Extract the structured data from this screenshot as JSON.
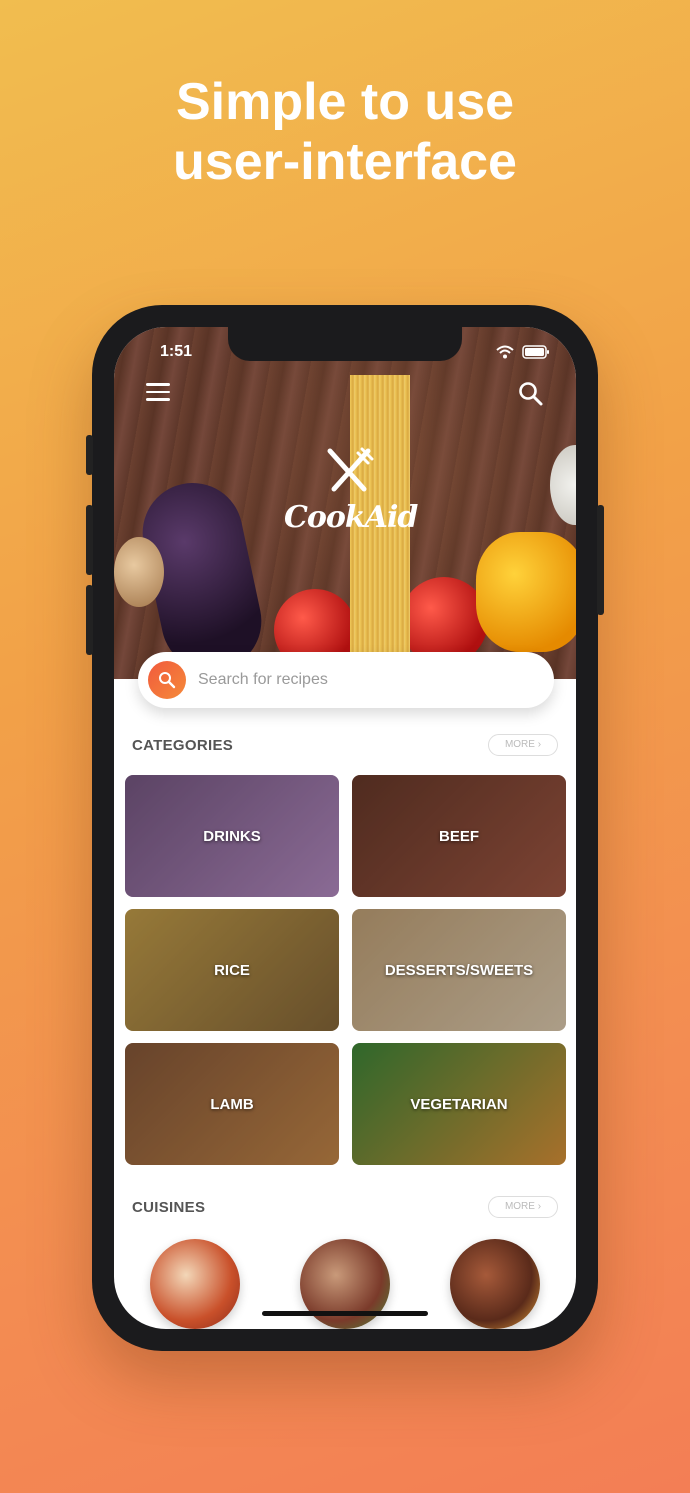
{
  "headline": {
    "line1": "Simple to use",
    "line2": "user-interface"
  },
  "status_bar": {
    "time": "1:51"
  },
  "app": {
    "logo_text": "CookAid"
  },
  "search": {
    "placeholder": "Search for recipes"
  },
  "categories": {
    "title": "CATEGORIES",
    "more_label": "MORE",
    "items": [
      {
        "label": "DRINKS",
        "colors": [
          "#7a5a86",
          "#b98fc7"
        ]
      },
      {
        "label": "BEEF",
        "colors": [
          "#6a3a2a",
          "#a65a45"
        ]
      },
      {
        "label": "RICE",
        "colors": [
          "#c9a24c",
          "#8a6a3a"
        ]
      },
      {
        "label": "DESSERTS/SWEETS",
        "colors": [
          "#c7a67a",
          "#e5d2b5"
        ]
      },
      {
        "label": "LAMB",
        "colors": [
          "#8a5a3a",
          "#c98a4a"
        ]
      },
      {
        "label": "VEGETARIAN",
        "colors": [
          "#3f8a3a",
          "#e0963a"
        ]
      }
    ]
  },
  "cuisines": {
    "title": "CUISINES",
    "more_label": "MORE"
  }
}
